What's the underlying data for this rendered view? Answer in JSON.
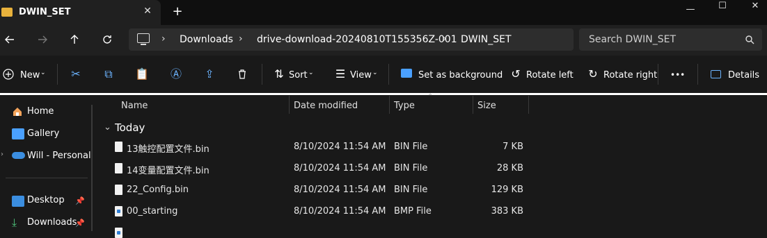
{
  "window": {
    "tab_title": "DWIN_SET",
    "tab_close": "✕",
    "new_tab": "+",
    "minimize": "—",
    "maximize": "☐",
    "close": "✕"
  },
  "address": {
    "crumbs": [
      "Downloads",
      "drive-download-20240810T155356Z-001",
      "DWIN_SET"
    ],
    "search_placeholder": "Search DWIN_SET"
  },
  "toolbar": {
    "new_label": "New",
    "sort_label": "Sort",
    "view_label": "View",
    "set_background_label": "Set as background",
    "rotate_left_label": "Rotate left",
    "rotate_right_label": "Rotate right",
    "more_label": "•••",
    "details_label": "Details"
  },
  "sidebar": {
    "items": [
      {
        "label": "Home"
      },
      {
        "label": "Gallery"
      },
      {
        "label": "Will - Personal"
      },
      {
        "label": "Desktop"
      },
      {
        "label": "Downloads"
      }
    ]
  },
  "columns": {
    "name": "Name",
    "date": "Date modified",
    "type": "Type",
    "size": "Size"
  },
  "group": {
    "label": "Today"
  },
  "files": [
    {
      "name": "13触控配置文件.bin",
      "date": "8/10/2024 11:54 AM",
      "type": "BIN File",
      "size": "7 KB"
    },
    {
      "name": "14变量配置文件.bin",
      "date": "8/10/2024 11:54 AM",
      "type": "BIN File",
      "size": "28 KB"
    },
    {
      "name": "22_Config.bin",
      "date": "8/10/2024 11:54 AM",
      "type": "BIN File",
      "size": "129 KB"
    },
    {
      "name": "00_starting",
      "date": "8/10/2024 11:54 AM",
      "type": "BMP File",
      "size": "383 KB"
    }
  ]
}
